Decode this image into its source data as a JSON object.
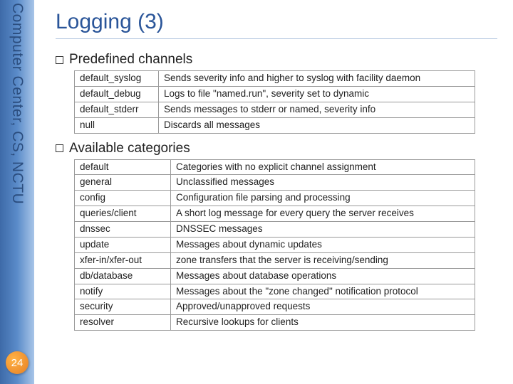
{
  "sidebar": {
    "org_text": "Computer Center, CS, NCTU",
    "page_number": "24"
  },
  "title": "Logging (3)",
  "sections": [
    {
      "heading": "Predefined channels",
      "rows": [
        [
          "default_syslog",
          "Sends severity info and higher to syslog with facility daemon"
        ],
        [
          "default_debug",
          "Logs to file \"named.run\", severity set to dynamic"
        ],
        [
          "default_stderr",
          "Sends messages to stderr or named, severity info"
        ],
        [
          "null",
          "Discards all messages"
        ]
      ]
    },
    {
      "heading": "Available categories",
      "rows": [
        [
          "default",
          "Categories with no explicit channel assignment"
        ],
        [
          "general",
          "Unclassified messages"
        ],
        [
          "config",
          "Configuration file parsing and processing"
        ],
        [
          "queries/client",
          "A short log message for every query the server receives"
        ],
        [
          "dnssec",
          "DNSSEC messages"
        ],
        [
          "update",
          "Messages about dynamic updates"
        ],
        [
          "xfer-in/xfer-out",
          "zone transfers that the server is receiving/sending"
        ],
        [
          "db/database",
          "Messages about database operations"
        ],
        [
          "notify",
          "Messages about the \"zone changed\" notification protocol"
        ],
        [
          "security",
          "Approved/unapproved requests"
        ],
        [
          "resolver",
          "Recursive lookups for clients"
        ]
      ]
    }
  ]
}
